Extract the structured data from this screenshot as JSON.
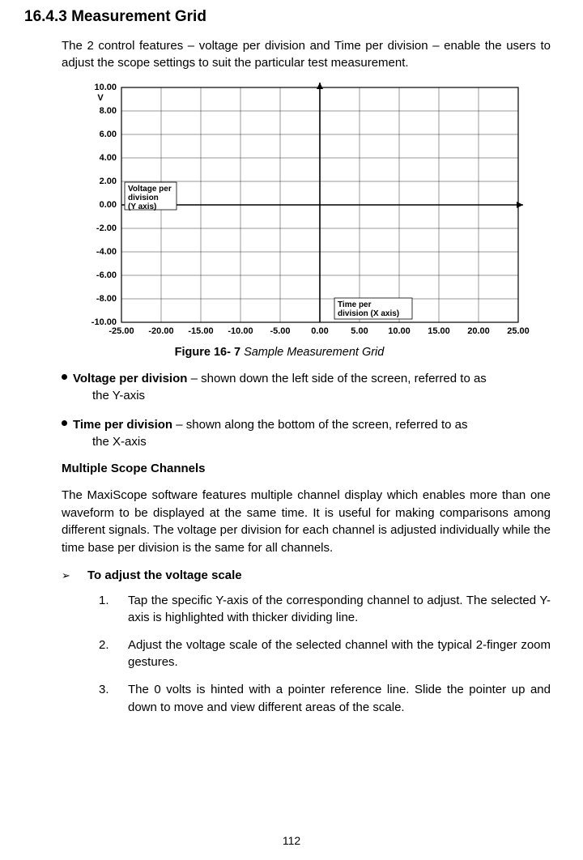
{
  "heading": "16.4.3 Measurement Grid",
  "intro": "The 2 control features – voltage per division and Time per division – enable the users to adjust the scope settings to suit the particular test measurement.",
  "figure": {
    "label": "Figure 16- 7",
    "title": " Sample Measurement Grid"
  },
  "bullets": [
    {
      "lead": "Voltage per division",
      "first": " – shown down the left side of the screen, referred to as",
      "rest": "the Y-axis"
    },
    {
      "lead": "Time per division",
      "first": " – shown along the bottom of the screen, referred to as",
      "rest": "the X-axis"
    }
  ],
  "subheading": "Multiple Scope Channels",
  "body": "The MaxiScope software features multiple channel display which enables more than one waveform to be displayed at the same time. It is useful for making comparisons among different signals. The voltage per division for each channel is adjusted individually while the time base per division is the same for all channels.",
  "arrow_label": "To adjust the voltage scale",
  "arrow_glyph": "➢",
  "steps": [
    {
      "n": "1.",
      "t": "Tap the specific Y-axis of the corresponding channel to adjust. The selected Y-axis is highlighted with thicker dividing line."
    },
    {
      "n": "2.",
      "t": "Adjust the voltage scale of the selected channel with the typical 2-finger zoom gestures."
    },
    {
      "n": "3.",
      "t": "The 0 volts is hinted with a pointer reference line. Slide the pointer up and down to move and view different areas of the scale."
    }
  ],
  "page_number": "112",
  "chart_data": {
    "type": "line",
    "title": "Sample Measurement Grid",
    "xlabel": "Time per division (X axis)",
    "ylabel": "Voltage per division (Y axis)",
    "y_unit": "V",
    "xlim": [
      -25.0,
      25.0
    ],
    "ylim": [
      -10.0,
      10.0
    ],
    "x_ticks": [
      -25.0,
      -20.0,
      -15.0,
      -10.0,
      -5.0,
      0.0,
      5.0,
      10.0,
      15.0,
      20.0,
      25.0
    ],
    "y_ticks": [
      -10.0,
      -8.0,
      -6.0,
      -4.0,
      -2.0,
      0.0,
      2.0,
      4.0,
      6.0,
      8.0,
      10.0
    ],
    "grid": true,
    "series": [],
    "annotations": [
      {
        "text": "Voltage per division (Y axis)",
        "pos": "left"
      },
      {
        "text": "Time per division (X axis)",
        "pos": "bottom"
      }
    ]
  }
}
